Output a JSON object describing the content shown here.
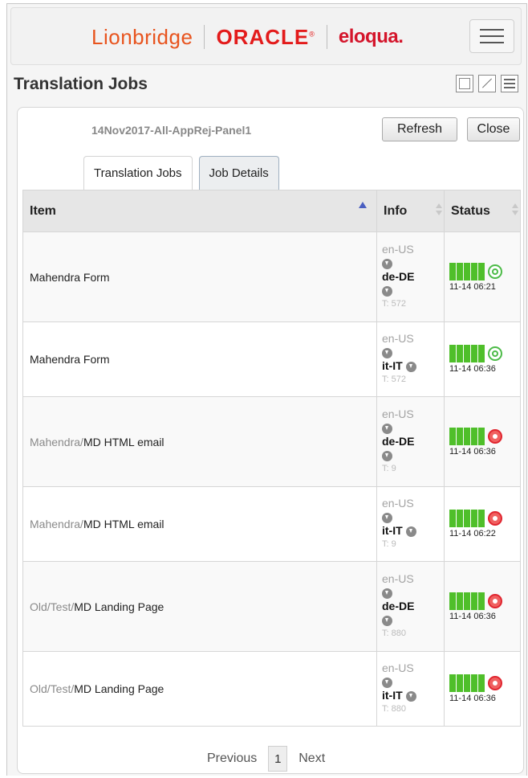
{
  "brand": {
    "lionbridge": "Lionbridge",
    "oracle": "ORACLE",
    "oracle_mark": "®",
    "eloqua": "eloqua."
  },
  "window": {
    "title": "Translation Jobs"
  },
  "job": {
    "name": "14Nov2017-All-AppRej-Panel1",
    "refresh_label": "Refresh",
    "close_label": "Close"
  },
  "tabs": [
    {
      "label": "Translation Jobs",
      "active": false
    },
    {
      "label": "Job Details",
      "active": true
    }
  ],
  "table": {
    "columns": [
      "Item",
      "Info",
      "Status"
    ],
    "rows": [
      {
        "path": "",
        "name": "Mahendra Form",
        "source": "en-US",
        "target": "de-DE",
        "tcount": "T: 572",
        "status": "ok",
        "timestamp": "11-14 06:21",
        "progress": 1.0
      },
      {
        "path": "",
        "name": "Mahendra Form",
        "source": "en-US",
        "target": "it-IT",
        "tcount": "T: 572",
        "status": "ok",
        "timestamp": "11-14 06:36",
        "progress": 1.0
      },
      {
        "path": "Mahendra/",
        "name": "MD HTML email",
        "source": "en-US",
        "target": "de-DE",
        "tcount": "T: 9",
        "status": "error",
        "timestamp": "11-14 06:36",
        "progress": 1.0
      },
      {
        "path": "Mahendra/",
        "name": "MD HTML email",
        "source": "en-US",
        "target": "it-IT",
        "tcount": "T: 9",
        "status": "error",
        "timestamp": "11-14 06:22",
        "progress": 1.0
      },
      {
        "path": "Old/Test/",
        "name": "MD Landing Page",
        "source": "en-US",
        "target": "de-DE",
        "tcount": "T: 880",
        "status": "error",
        "timestamp": "11-14 06:36",
        "progress": 1.0
      },
      {
        "path": "Old/Test/",
        "name": "MD Landing Page",
        "source": "en-US",
        "target": "it-IT",
        "tcount": "T: 880",
        "status": "error",
        "timestamp": "11-14 06:36",
        "progress": 1.0
      }
    ]
  },
  "pager": {
    "previous": "Previous",
    "page": "1",
    "next": "Next"
  },
  "colors": {
    "lionbridge": "#e8541e",
    "oracle": "#e31b1b",
    "eloqua": "#d4152b",
    "progress": "#4fbf2a",
    "status_ok": "#4dbb48",
    "status_error": "#e0252f"
  }
}
